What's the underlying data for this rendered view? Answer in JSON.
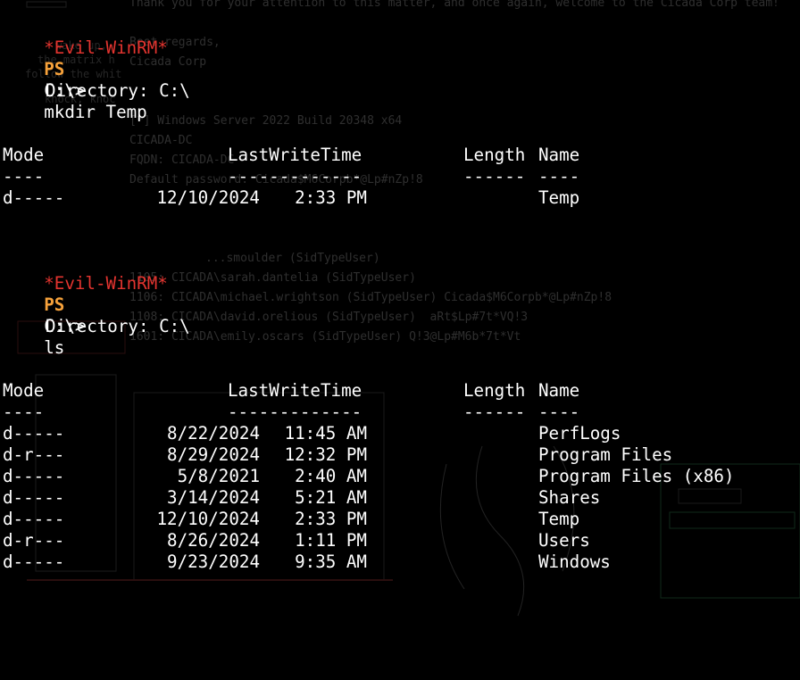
{
  "background": {
    "lines": [
      "Thank you for your attention to this matter, and once again, welcome to the Cicada Corp team!",
      "Best regards,",
      "Cicada Corp",
      "[*] Windows Server 2022 Build 20348 x64",
      "CICADA-DC",
      "FQDN: CICADA-DC",
      "Default password: Cicada$M6Corpb*@Lp#nZp!8",
      "...smoulder (SidTypeUser)",
      "1105: CICADA\\sarah.dantelia (SidTypeUser)",
      "1106: CICADA\\michael.wrightson (SidTypeUser) Cicada$M6Corpb*@Lp#nZp!8",
      "1108: CICADA\\david.orelious (SidTypeUser)  aRt$Lp#7t*VQ!3",
      "1601: CICADA\\emily.oscars (SidTypeUser) Q!3@Lp#M6b*7t*Vt"
    ],
    "art": [
      "wake up, ",
      "the matrix h",
      "follow the whit",
      "knock, knoc"
    ]
  },
  "terminal": {
    "prompt": {
      "evil": "*Evil-WinRM*",
      "ps": "PS",
      "path": "C:\\>"
    },
    "blocks": [
      {
        "command": "mkdir Temp",
        "directory_label": "Directory: C:\\",
        "headers": {
          "mode": "Mode",
          "lwt": "LastWriteTime",
          "length": "Length",
          "name": "Name"
        },
        "separators": {
          "mode": "----",
          "lwt": "-------------",
          "length": "------",
          "name": "----"
        },
        "rows": [
          {
            "mode": "d-----",
            "date": "12/10/2024",
            "time": "2:33 PM",
            "length": "",
            "name": "Temp"
          }
        ]
      },
      {
        "command": "ls",
        "directory_label": "Directory: C:\\",
        "headers": {
          "mode": "Mode",
          "lwt": "LastWriteTime",
          "length": "Length",
          "name": "Name"
        },
        "separators": {
          "mode": "----",
          "lwt": "-------------",
          "length": "------",
          "name": "----"
        },
        "rows": [
          {
            "mode": "d-----",
            "date": "8/22/2024",
            "time": "11:45 AM",
            "length": "",
            "name": "PerfLogs"
          },
          {
            "mode": "d-r---",
            "date": "8/29/2024",
            "time": "12:32 PM",
            "length": "",
            "name": "Program Files"
          },
          {
            "mode": "d-----",
            "date": "5/8/2021",
            "time": "2:40 AM",
            "length": "",
            "name": "Program Files (x86)"
          },
          {
            "mode": "d-----",
            "date": "3/14/2024",
            "time": "5:21 AM",
            "length": "",
            "name": "Shares"
          },
          {
            "mode": "d-----",
            "date": "12/10/2024",
            "time": "2:33 PM",
            "length": "",
            "name": "Temp"
          },
          {
            "mode": "d-r---",
            "date": "8/26/2024",
            "time": "1:11 PM",
            "length": "",
            "name": "Users"
          },
          {
            "mode": "d-----",
            "date": "9/23/2024",
            "time": "9:35 AM",
            "length": "",
            "name": "Windows"
          }
        ]
      }
    ]
  }
}
